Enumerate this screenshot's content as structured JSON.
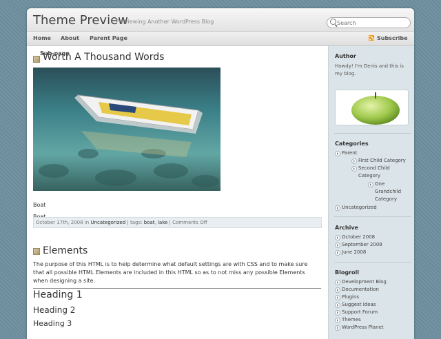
{
  "header": {
    "site_title": "Theme Preview",
    "tagline": "Previewing Another WordPress Blog",
    "search_placeholder": "Search"
  },
  "nav": {
    "items": [
      "Home",
      "About",
      "Parent Page"
    ],
    "submenu_item": "Sub-page",
    "subscribe": "Subscribe"
  },
  "post1": {
    "title": "Worth A Thousand Words",
    "caption": "Boat",
    "body": "Boat.",
    "date": "October 17th, 2008",
    "in_label": "in",
    "category": "Uncategorized",
    "tags_label": "| tags:",
    "tag1": "boat",
    "tag2": "lake",
    "comments": "| Comments Off"
  },
  "post2": {
    "title": "Elements",
    "body": "The purpose of this HTML is to help determine what default settings are with CSS and to make sure that all possible HTML Elements are included in this HTML so as to not miss any possible Elements when designing a site.",
    "h1": "Heading 1",
    "h2": "Heading 2",
    "h3": "Heading 3"
  },
  "sidebar": {
    "author_title": "Author",
    "author_text": "Howdy! I'm Denis and this is my blog.",
    "categories_title": "Categories",
    "categories": [
      "Parent",
      "First Child Category",
      "Second Child Category",
      "One Grandchild Category",
      "Uncategorized"
    ],
    "archive_title": "Archive",
    "archive": [
      "October 2008",
      "September 2008",
      "June 2008"
    ],
    "blogroll_title": "Blogroll",
    "blogroll": [
      "Development Blog",
      "Documentation",
      "Plugins",
      "Suggest Ideas",
      "Support Forum",
      "Themes",
      "WordPress Planet"
    ]
  },
  "colors": {
    "background": "#6e8f9f",
    "sidebar": "#dbe4e8",
    "meta_bar": "#e8eef1"
  }
}
